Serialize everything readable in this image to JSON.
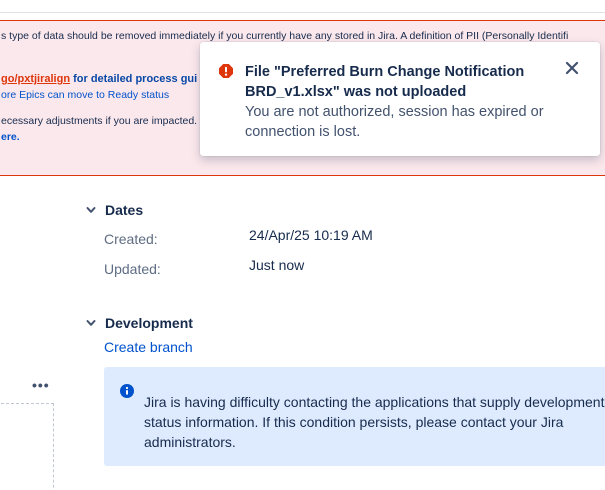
{
  "banner": {
    "line1": "s type of data should be removed immediately if you currently have any stored in Jira. A definition of PII (Personally Identifi",
    "line2_link": "go/pxtjiralign",
    "line2_rest": " for detailed process gui",
    "line3": "ore Epics can move to Ready status",
    "line4": "ecessary adjustments if you are impacted.",
    "line5": "ere."
  },
  "toast": {
    "title": "File \"Preferred Burn Change Notification BRD_v1.xlsx\" was not uploaded",
    "body": "You are not authorized, session has expired or connection is lost.",
    "icon": "error-icon",
    "close_icon": "close-icon",
    "color": "#de350b"
  },
  "dates": {
    "heading": "Dates",
    "created_label": "Created:",
    "created_value": "24/Apr/25 10:19 AM",
    "updated_label": "Updated:",
    "updated_value": "Just now"
  },
  "development": {
    "heading": "Development",
    "create_branch": "Create branch",
    "more_label": "•••",
    "info_message": "Jira is having difficulty contacting the applications that supply development status information. If this condition persists, please contact your Jira administrators.",
    "info_color": "#0052cc"
  }
}
